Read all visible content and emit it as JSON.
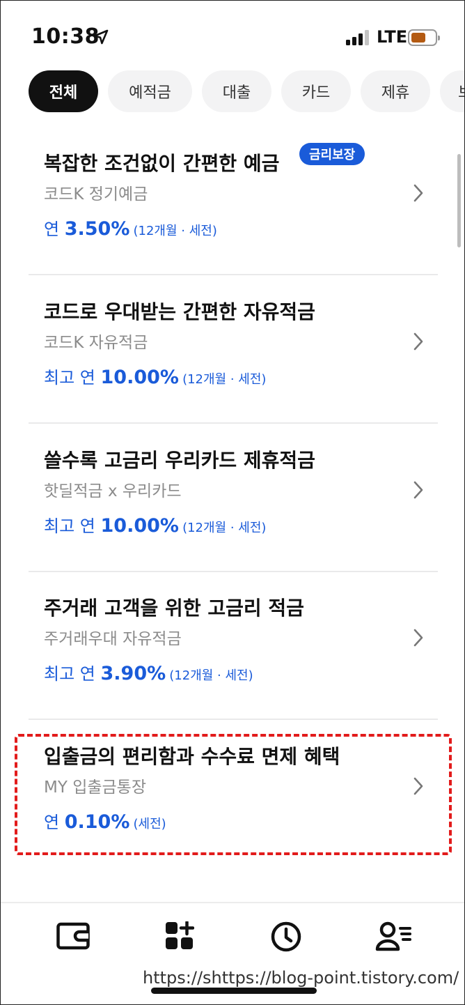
{
  "status_bar": {
    "time": "10:38",
    "network": "LTE",
    "battery_color": "#b35a12"
  },
  "tabs": [
    {
      "label": "전체",
      "active": true
    },
    {
      "label": "예적금",
      "active": false
    },
    {
      "label": "대출",
      "active": false
    },
    {
      "label": "카드",
      "active": false
    },
    {
      "label": "제휴",
      "active": false
    },
    {
      "label": "보",
      "active": false
    }
  ],
  "products": [
    {
      "title": "복잡한 조건없이 간편한 예금",
      "badge": "금리보장",
      "name": "코드K 정기예금",
      "rate_prefix": "연 ",
      "rate": "3.50%",
      "rate_note": "(12개월 · 세전)"
    },
    {
      "title": "코드로 우대받는 간편한 자유적금",
      "name": "코드K 자유적금",
      "rate_prefix": "최고 연 ",
      "rate": "10.00%",
      "rate_note": "(12개월 · 세전)"
    },
    {
      "title": "쓸수록 고금리 우리카드 제휴적금",
      "name": "핫딜적금 x 우리카드",
      "rate_prefix": "최고 연 ",
      "rate": "10.00%",
      "rate_note": "(12개월 · 세전)"
    },
    {
      "title": "주거래 고객을 위한 고금리 적금",
      "name": "주거래우대 자유적금",
      "rate_prefix": "최고 연 ",
      "rate": "3.90%",
      "rate_note": "(12개월 · 세전)"
    },
    {
      "title": "입출금의 편리함과 수수료 면제 혜택",
      "name": "MY 입출금통장",
      "rate_prefix": "연 ",
      "rate": "0.10%",
      "rate_note": "(세전)"
    }
  ],
  "bottom_nav": [
    {
      "icon": "wallet-icon"
    },
    {
      "icon": "apps-plus-icon"
    },
    {
      "icon": "clock-icon"
    },
    {
      "icon": "user-menu-icon"
    }
  ],
  "watermark": "https://shttps://blog-point.tistory.com/",
  "colors": {
    "accent": "#1a5bd9",
    "highlight_border": "#e21b1b"
  }
}
